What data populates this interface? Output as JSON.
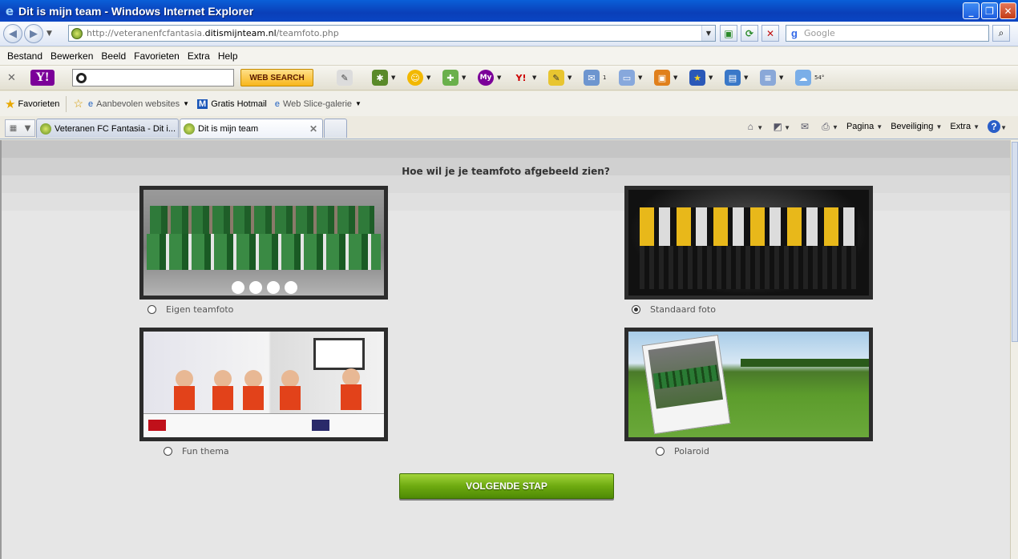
{
  "window": {
    "title": "Dit is mijn team - Windows Internet Explorer"
  },
  "address": {
    "url_prefix": "http://veteranenfcfantasia.",
    "url_domain": "ditismijnteam.nl",
    "url_path": "/teamfoto.php",
    "search_placeholder": "Google"
  },
  "menu": [
    "Bestand",
    "Bewerken",
    "Beeld",
    "Favorieten",
    "Extra",
    "Help"
  ],
  "yahoo": {
    "search_button": "WEB SEARCH",
    "mail_count": "1",
    "weather": "54°"
  },
  "favorites": {
    "label": "Favorieten",
    "items": [
      "Aanbevolen websites",
      "Gratis Hotmail",
      "Web Slice-galerie"
    ]
  },
  "tabs": [
    {
      "label": "Veteranen FC Fantasia - Dit i..."
    },
    {
      "label": "Dit is mijn team"
    }
  ],
  "command_bar": [
    "Pagina",
    "Beveiliging",
    "Extra"
  ],
  "page": {
    "heading": "Hoe wil je je teamfoto afgebeeld zien?",
    "options": [
      {
        "label": "Eigen teamfoto",
        "selected": false
      },
      {
        "label": "Standaard foto",
        "selected": true
      },
      {
        "label": "Fun thema",
        "selected": false
      },
      {
        "label": "Polaroid",
        "selected": false
      }
    ],
    "next_button": "VOLGENDE STAP"
  },
  "colors": {
    "title_bar": "#0a4fd0",
    "button_green": "#6eaa10",
    "content_bg": "#e6e6e6",
    "photo_frame": "#2c2c2c"
  },
  "icons": [
    "ie-icon",
    "back-icon",
    "forward-icon",
    "refresh-icon",
    "stop-icon",
    "search-icon",
    "favorites-star-icon",
    "home-icon",
    "rss-icon",
    "mail-icon",
    "print-icon",
    "help-icon"
  ]
}
